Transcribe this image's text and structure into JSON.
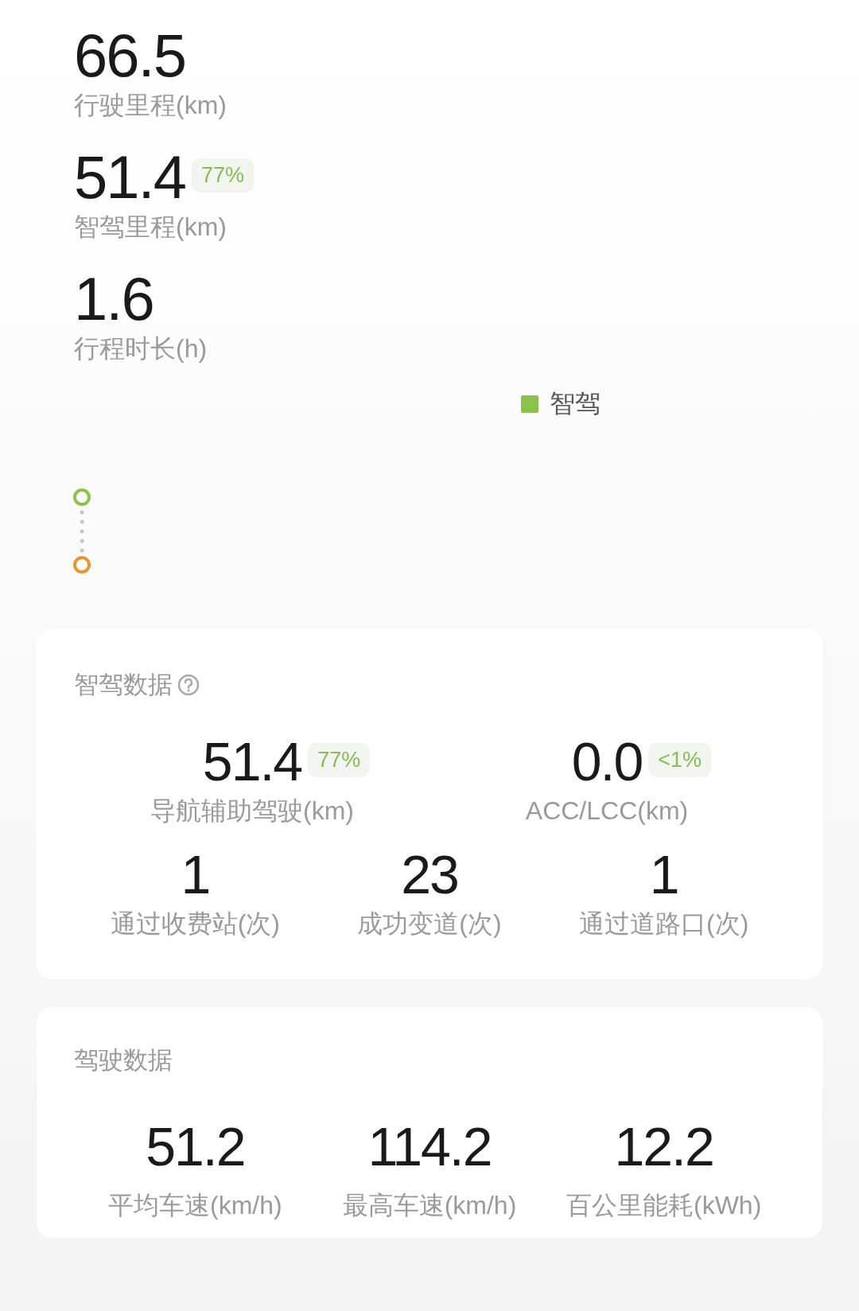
{
  "trip_summary": [
    {
      "value": "66.5",
      "label": "行驶里程(km)"
    },
    {
      "value": "51.4",
      "badge": "77%",
      "label": "智驾里程(km)"
    },
    {
      "value": "1.6",
      "label": "行程时长(h)"
    }
  ],
  "map_legend": [
    {
      "label": "智驾",
      "color": "#8bc34a"
    }
  ],
  "smart_driving_data": {
    "title": "智驾数据",
    "primary": [
      {
        "value": "51.4",
        "badge": "77%",
        "label": "导航辅助驾驶(km)"
      },
      {
        "value": "0.0",
        "badge": "<1%",
        "label": "ACC/LCC(km)"
      }
    ],
    "secondary": [
      {
        "value": "1",
        "label": "通过收费站(次)"
      },
      {
        "value": "23",
        "label": "成功变道(次)"
      },
      {
        "value": "1",
        "label": "通过道路口(次)"
      }
    ]
  },
  "driving_data": {
    "title": "驾驶数据",
    "stats": [
      {
        "value": "51.2",
        "label": "平均车速(km/h)"
      },
      {
        "value": "114.2",
        "label": "最高车速(km/h)"
      },
      {
        "value": "12.2",
        "label": "百公里能耗(kWh)"
      }
    ]
  }
}
